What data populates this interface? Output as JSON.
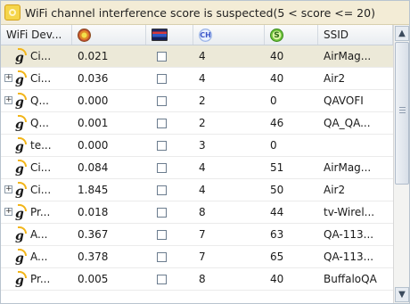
{
  "title": {
    "text": "WiFi channel interference score is suspected(5 < score <= 20)",
    "icon": "interference-warning-icon"
  },
  "columns": [
    {
      "label": "WiFi Dev..."
    },
    {
      "label": "",
      "icon": "signal-score-icon"
    },
    {
      "label": "",
      "icon": "spectrum-icon"
    },
    {
      "label": "",
      "icon": "channel-icon",
      "icon_text": "CH"
    },
    {
      "label": "",
      "icon": "strength-icon",
      "icon_text": "S"
    },
    {
      "label": "SSID"
    }
  ],
  "rows": [
    {
      "expandable": false,
      "selected": true,
      "device": "Ci...",
      "score": "0.021",
      "channel": "4",
      "strength": "40",
      "ssid": "AirMag..."
    },
    {
      "expandable": true,
      "selected": false,
      "device": "Ci...",
      "score": "0.036",
      "channel": "4",
      "strength": "40",
      "ssid": "Air2"
    },
    {
      "expandable": true,
      "selected": false,
      "device": "Q...",
      "score": "0.000",
      "channel": "2",
      "strength": "0",
      "ssid": "QAVOFI"
    },
    {
      "expandable": false,
      "selected": false,
      "device": "Q...",
      "score": "0.001",
      "channel": "2",
      "strength": "46",
      "ssid": "QA_QA..."
    },
    {
      "expandable": false,
      "selected": false,
      "device": "te...",
      "score": "0.000",
      "channel": "3",
      "strength": "0",
      "ssid": ""
    },
    {
      "expandable": false,
      "selected": false,
      "device": "Ci...",
      "score": "0.084",
      "channel": "4",
      "strength": "51",
      "ssid": "AirMag..."
    },
    {
      "expandable": true,
      "selected": false,
      "device": "Ci...",
      "score": "1.845",
      "channel": "4",
      "strength": "50",
      "ssid": "Air2"
    },
    {
      "expandable": true,
      "selected": false,
      "device": "Pr...",
      "score": "0.018",
      "channel": "8",
      "strength": "44",
      "ssid": "tv-Wirel..."
    },
    {
      "expandable": false,
      "selected": false,
      "device": "A...",
      "score": "0.367",
      "channel": "7",
      "strength": "63",
      "ssid": "QA-113..."
    },
    {
      "expandable": false,
      "selected": false,
      "device": "A...",
      "score": "0.378",
      "channel": "7",
      "strength": "65",
      "ssid": "QA-113..."
    },
    {
      "expandable": false,
      "selected": false,
      "device": "Pr...",
      "score": "0.005",
      "channel": "8",
      "strength": "40",
      "ssid": "BuffaloQA"
    }
  ],
  "scrollbar": {
    "up_icon": "scroll-up-arrow-icon",
    "down_icon": "scroll-down-arrow-icon"
  }
}
